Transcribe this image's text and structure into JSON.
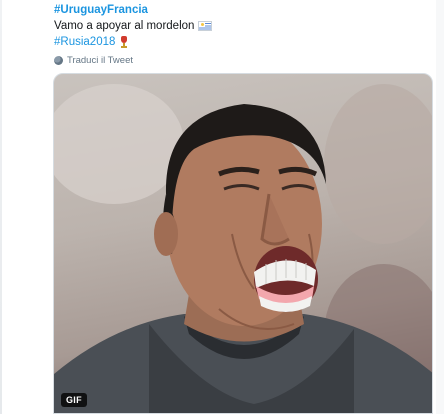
{
  "tweet": {
    "hashtag_top": "#UruguayFrancia",
    "text": "Vamo a apoyar al mordelon",
    "flag_icon": "uruguay-flag-icon",
    "hashtag_bottom": "#Rusia2018",
    "trophy_icon": "world-cup-trophy-icon"
  },
  "translate": {
    "icon": "globe-icon",
    "label": "Traduci il Tweet"
  },
  "media": {
    "badge": "GIF",
    "description_icon": "animated-gif"
  },
  "colors": {
    "link": "#1b95e0",
    "muted": "#657786",
    "text": "#14171a"
  }
}
